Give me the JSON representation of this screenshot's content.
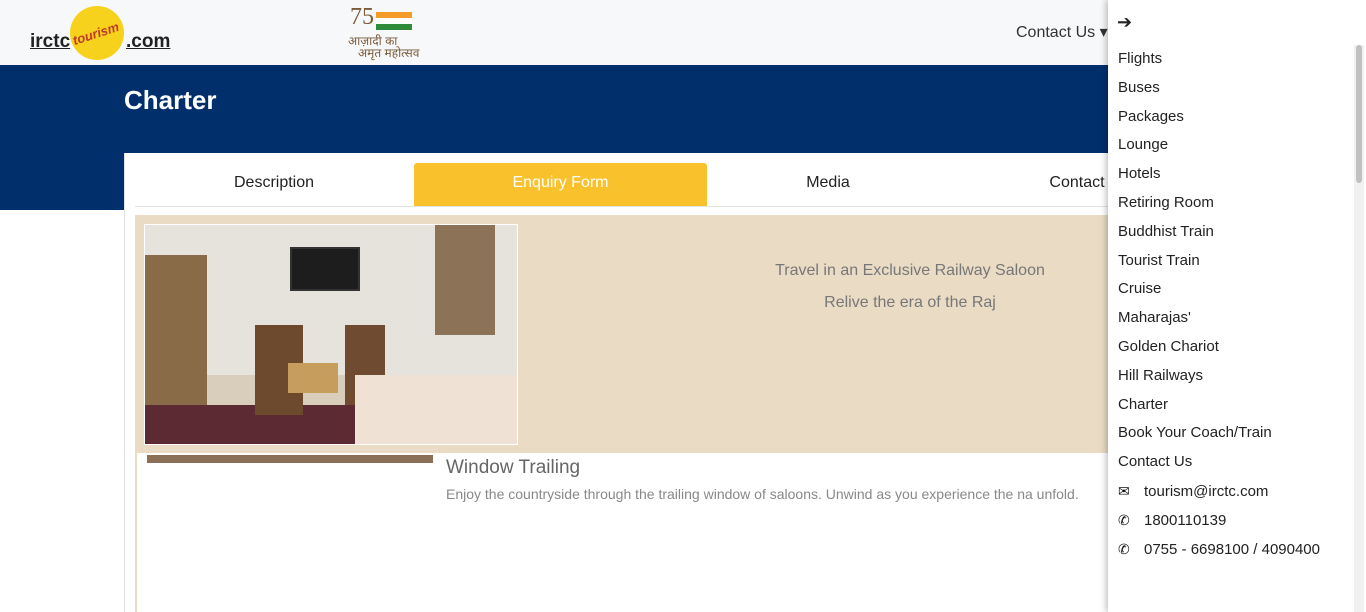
{
  "header": {
    "logo_left": "irctc",
    "logo_right": ".com",
    "logo_mark": "tourism",
    "azadi_num": "75",
    "azadi_line1": "आज़ादी का",
    "azadi_line2": "अमृत महोत्सव",
    "nav_contact": "Contact Us ▾"
  },
  "page": {
    "title": "Charter"
  },
  "tabs": [
    {
      "label": "Description"
    },
    {
      "label": "Enquiry Form"
    },
    {
      "label": "Media"
    },
    {
      "label": "Contact"
    }
  ],
  "hero": {
    "tagline1": "Travel in an Exclusive Railway Saloon",
    "tagline2": "Relive the era of the Raj"
  },
  "feature": {
    "title": "Window Trailing",
    "description": "Enjoy the countryside through the trailing window of saloons. Unwind as you experience the na unfold."
  },
  "drawer": {
    "back_icon": "arrow-right-icon",
    "items": [
      {
        "label": "Flights"
      },
      {
        "label": "Buses"
      },
      {
        "label": "Packages"
      },
      {
        "label": "Lounge"
      },
      {
        "label": "Hotels"
      },
      {
        "label": "Retiring Room"
      },
      {
        "label": "Buddhist Train"
      },
      {
        "label": "Tourist Train"
      },
      {
        "label": "Cruise"
      },
      {
        "label": "Maharajas'"
      },
      {
        "label": "Golden Chariot"
      },
      {
        "label": "Hill Railways"
      },
      {
        "label": "Charter"
      },
      {
        "label": "Book Your Coach/Train"
      },
      {
        "label": "Contact Us"
      }
    ],
    "email": "tourism@irctc.com",
    "phone1": "1800110139",
    "phone2": "0755 - 6698100 / 4090400"
  },
  "colors": {
    "header_band": "#002f6c",
    "active_tab": "#f9c12b",
    "hero_bg": "#eadbc4"
  }
}
